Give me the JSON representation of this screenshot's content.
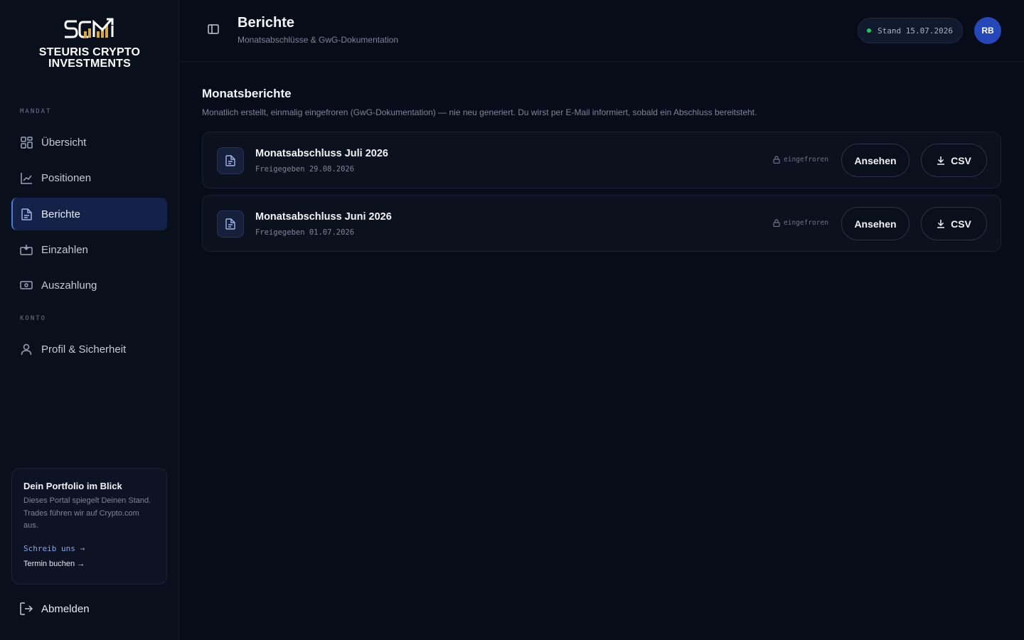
{
  "brand": {
    "line1": "STEURIS CRYPTO",
    "line2": "INVESTMENTS",
    "mark": "SCI"
  },
  "sidebar": {
    "section_mandat": "MANDAT",
    "section_konto": "KONTO",
    "items": [
      {
        "label": "Übersicht",
        "icon": "grid-icon"
      },
      {
        "label": "Positionen",
        "icon": "chart-line-icon"
      },
      {
        "label": "Berichte",
        "icon": "document-icon",
        "active": true
      },
      {
        "label": "Einzahlen",
        "icon": "deposit-icon"
      },
      {
        "label": "Auszahlung",
        "icon": "cash-icon"
      },
      {
        "label": "Profil & Sicherheit",
        "icon": "user-icon"
      }
    ],
    "promo": {
      "title": "Dein Portfolio im Blick",
      "text": "Dieses Portal spiegelt Deinen Stand. Trades führen wir auf Crypto.com aus.",
      "link_write": "Schreib uns →",
      "link_book": "Termin buchen →"
    },
    "logout": "Abmelden"
  },
  "header": {
    "title": "Berichte",
    "subtitle": "Monatsabschlüsse & GwG-Dokumentation",
    "stand": "Stand 15.07.2026",
    "avatar": "RB"
  },
  "main": {
    "title": "Monatsberichte",
    "description": "Monatlich erstellt, einmalig eingefroren (GwG-Dokumentation) — nie neu generiert. Du wirst per E-Mail informiert, sobald ein Abschluss bereitsteht.",
    "reports": [
      {
        "name": "Monatsabschluss Juli 2026",
        "released": "Freigegeben 29.08.2026",
        "status": "eingefroren",
        "view_label": "Ansehen",
        "csv_label": "CSV"
      },
      {
        "name": "Monatsabschluss Juni 2026",
        "released": "Freigegeben 01.07.2026",
        "status": "eingefroren",
        "view_label": "Ansehen",
        "csv_label": "CSV"
      }
    ]
  },
  "colors": {
    "accent": "#4f7be0",
    "status_green": "#22c55e",
    "avatar_bg": "#2547b8",
    "gold": "#d4a84a"
  }
}
